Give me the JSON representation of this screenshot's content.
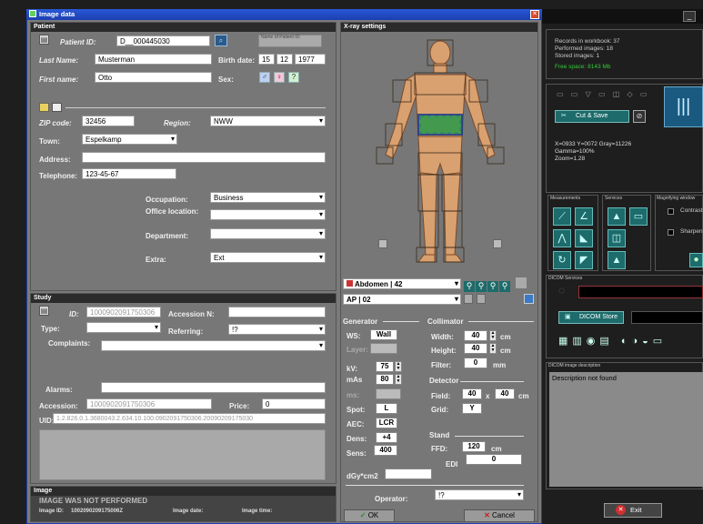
{
  "window": {
    "title": "Image data",
    "close_icon": "close-icon"
  },
  "patient": {
    "section": "Patient",
    "patient_id_label": "Patient ID:",
    "patient_id": "D__000445030",
    "name_of_patient_caption": "Name of Patient ID:",
    "last_name_label": "Last Name:",
    "last_name": "Musterman",
    "birth_date_label": "Birth date:",
    "birth_day": "15",
    "birth_month": "12",
    "birth_year": "1977",
    "first_name_label": "First name:",
    "first_name": "Otto",
    "sex_label": "Sex:",
    "sex_male": "♂",
    "sex_female": "♀",
    "sex_unknown": "?",
    "zip_label": "ZIP code:",
    "zip": "32456",
    "region_label": "Region:",
    "region": "NWW",
    "town_label": "Town:",
    "town": "Espelkamp",
    "address_label": "Address:",
    "address": "",
    "telephone_label": "Telephone:",
    "telephone": "123-45-67",
    "occupation_label": "Occupation:",
    "occupation": "Business",
    "office_label": "Office location:",
    "office": "",
    "department_label": "Department:",
    "department": "",
    "extra_label": "Extra:",
    "extra": "Ext"
  },
  "study": {
    "section": "Study",
    "id_label": "ID:",
    "id": "1000902091750306",
    "accession_n_label": "Accession N:",
    "accession_n": "",
    "type_label": "Type:",
    "type": "",
    "referring_label": "Referring:",
    "referring": "!?",
    "complaints_label": "Complaints:",
    "complaints": "",
    "alarms_label": "Alarms:",
    "alarms": "",
    "accession_label": "Accession:",
    "accession": "1000902091750306",
    "price_label": "Price:",
    "price": "0",
    "uid_label": "UID:",
    "uid": "1.2.826.0.1.3680043.2.634.10.100.0902091750306.20090209175030"
  },
  "image": {
    "section": "Image",
    "status": "IMAGE WAS NOT PERFORMED",
    "image_id_label": "Image ID:",
    "image_id": "1002090209175006Z",
    "image_date_label": "Image date:",
    "image_time_label": "Image time:"
  },
  "xray": {
    "section": "X-ray settings",
    "body_part": "Abdomen | 42",
    "projection": "AP | 02",
    "generator_label": "Generator",
    "ws_label": "WS:",
    "ws": "Wall",
    "layer_label": "Layer:",
    "kv_label": "kV:",
    "kv": "75",
    "mas_label": "mAs",
    "mas": "80",
    "ms_label": "ms:",
    "spot_label": "Spot:",
    "spot": "L",
    "aec_label": "AEC:",
    "aec": "LCR",
    "dens_label": "Dens:",
    "dens": "+4",
    "sens_label": "Sens:",
    "sens": "400",
    "collimator_label": "Collimator",
    "width_label": "Width:",
    "width": "40",
    "width_unit": "cm",
    "height_label": "Height:",
    "height": "40",
    "height_unit": "cm",
    "filter_label": "Filter:",
    "filter": "0",
    "filter_unit": "mm",
    "detector_label": "Detector",
    "field_label": "Field:",
    "field_w": "40",
    "field_x": "x",
    "field_h": "40",
    "field_unit": "cm",
    "grid_label": "Grid:",
    "grid": "Y",
    "stand_label": "Stand",
    "ffd_label": "FFD:",
    "ffd": "120",
    "ffd_unit": "cm",
    "edi_label": "EDI",
    "edi": "0",
    "dgy_label": "dGy*cm2",
    "dgy": "",
    "operator_label": "Operator:",
    "operator": "!?",
    "ok_label": "OK",
    "cancel_label": "Cancel"
  },
  "right": {
    "stats": [
      "Records in workbook: 37",
      "Performed images: 18",
      "Stored images: 1"
    ],
    "free_space": "Free space: 8143 Mb",
    "cut_save_label": "Cut & Save",
    "coords": [
      "X=0933   Y=0072    Gray=11226",
      "Gamma=100%",
      "Zoom=1.28"
    ],
    "measurements_label": "Measurements",
    "services_label": "Services",
    "magnifying_label": "Magnifying window",
    "contrast_label": "Contrast",
    "sharpen_label": "Sharpen",
    "dicom_services_label": "DICOM Services",
    "dicom_store_label": "DICOM Store",
    "dicom_desc_label": "DICOM image description",
    "description": "Description not found",
    "exit_label": "Exit"
  },
  "colors": {
    "window_blue": "#1c3fb0",
    "panel_gray": "#777777",
    "right_bg": "#1e1e1e",
    "teal": "#1d6b6b",
    "red": "#d03030"
  }
}
